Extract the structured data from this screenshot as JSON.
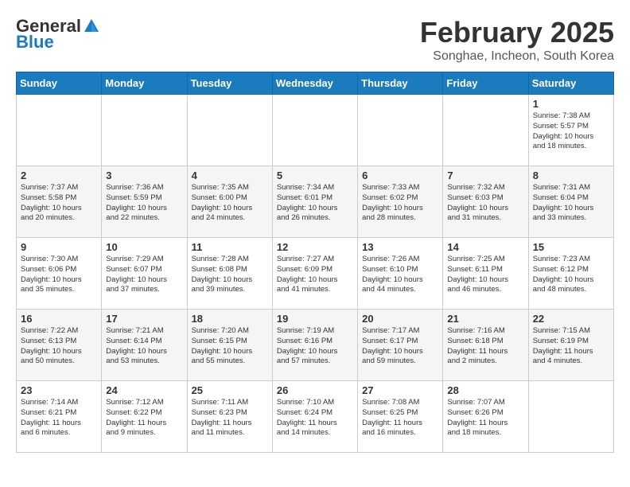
{
  "header": {
    "logo_general": "General",
    "logo_blue": "Blue",
    "month_title": "February 2025",
    "location": "Songhae, Incheon, South Korea"
  },
  "weekdays": [
    "Sunday",
    "Monday",
    "Tuesday",
    "Wednesday",
    "Thursday",
    "Friday",
    "Saturday"
  ],
  "weeks": [
    {
      "days": [
        {
          "num": "",
          "info": ""
        },
        {
          "num": "",
          "info": ""
        },
        {
          "num": "",
          "info": ""
        },
        {
          "num": "",
          "info": ""
        },
        {
          "num": "",
          "info": ""
        },
        {
          "num": "",
          "info": ""
        },
        {
          "num": "1",
          "info": "Sunrise: 7:38 AM\nSunset: 5:57 PM\nDaylight: 10 hours\nand 18 minutes."
        }
      ]
    },
    {
      "days": [
        {
          "num": "2",
          "info": "Sunrise: 7:37 AM\nSunset: 5:58 PM\nDaylight: 10 hours\nand 20 minutes."
        },
        {
          "num": "3",
          "info": "Sunrise: 7:36 AM\nSunset: 5:59 PM\nDaylight: 10 hours\nand 22 minutes."
        },
        {
          "num": "4",
          "info": "Sunrise: 7:35 AM\nSunset: 6:00 PM\nDaylight: 10 hours\nand 24 minutes."
        },
        {
          "num": "5",
          "info": "Sunrise: 7:34 AM\nSunset: 6:01 PM\nDaylight: 10 hours\nand 26 minutes."
        },
        {
          "num": "6",
          "info": "Sunrise: 7:33 AM\nSunset: 6:02 PM\nDaylight: 10 hours\nand 28 minutes."
        },
        {
          "num": "7",
          "info": "Sunrise: 7:32 AM\nSunset: 6:03 PM\nDaylight: 10 hours\nand 31 minutes."
        },
        {
          "num": "8",
          "info": "Sunrise: 7:31 AM\nSunset: 6:04 PM\nDaylight: 10 hours\nand 33 minutes."
        }
      ]
    },
    {
      "days": [
        {
          "num": "9",
          "info": "Sunrise: 7:30 AM\nSunset: 6:06 PM\nDaylight: 10 hours\nand 35 minutes."
        },
        {
          "num": "10",
          "info": "Sunrise: 7:29 AM\nSunset: 6:07 PM\nDaylight: 10 hours\nand 37 minutes."
        },
        {
          "num": "11",
          "info": "Sunrise: 7:28 AM\nSunset: 6:08 PM\nDaylight: 10 hours\nand 39 minutes."
        },
        {
          "num": "12",
          "info": "Sunrise: 7:27 AM\nSunset: 6:09 PM\nDaylight: 10 hours\nand 41 minutes."
        },
        {
          "num": "13",
          "info": "Sunrise: 7:26 AM\nSunset: 6:10 PM\nDaylight: 10 hours\nand 44 minutes."
        },
        {
          "num": "14",
          "info": "Sunrise: 7:25 AM\nSunset: 6:11 PM\nDaylight: 10 hours\nand 46 minutes."
        },
        {
          "num": "15",
          "info": "Sunrise: 7:23 AM\nSunset: 6:12 PM\nDaylight: 10 hours\nand 48 minutes."
        }
      ]
    },
    {
      "days": [
        {
          "num": "16",
          "info": "Sunrise: 7:22 AM\nSunset: 6:13 PM\nDaylight: 10 hours\nand 50 minutes."
        },
        {
          "num": "17",
          "info": "Sunrise: 7:21 AM\nSunset: 6:14 PM\nDaylight: 10 hours\nand 53 minutes."
        },
        {
          "num": "18",
          "info": "Sunrise: 7:20 AM\nSunset: 6:15 PM\nDaylight: 10 hours\nand 55 minutes."
        },
        {
          "num": "19",
          "info": "Sunrise: 7:19 AM\nSunset: 6:16 PM\nDaylight: 10 hours\nand 57 minutes."
        },
        {
          "num": "20",
          "info": "Sunrise: 7:17 AM\nSunset: 6:17 PM\nDaylight: 10 hours\nand 59 minutes."
        },
        {
          "num": "21",
          "info": "Sunrise: 7:16 AM\nSunset: 6:18 PM\nDaylight: 11 hours\nand 2 minutes."
        },
        {
          "num": "22",
          "info": "Sunrise: 7:15 AM\nSunset: 6:19 PM\nDaylight: 11 hours\nand 4 minutes."
        }
      ]
    },
    {
      "days": [
        {
          "num": "23",
          "info": "Sunrise: 7:14 AM\nSunset: 6:21 PM\nDaylight: 11 hours\nand 6 minutes."
        },
        {
          "num": "24",
          "info": "Sunrise: 7:12 AM\nSunset: 6:22 PM\nDaylight: 11 hours\nand 9 minutes."
        },
        {
          "num": "25",
          "info": "Sunrise: 7:11 AM\nSunset: 6:23 PM\nDaylight: 11 hours\nand 11 minutes."
        },
        {
          "num": "26",
          "info": "Sunrise: 7:10 AM\nSunset: 6:24 PM\nDaylight: 11 hours\nand 14 minutes."
        },
        {
          "num": "27",
          "info": "Sunrise: 7:08 AM\nSunset: 6:25 PM\nDaylight: 11 hours\nand 16 minutes."
        },
        {
          "num": "28",
          "info": "Sunrise: 7:07 AM\nSunset: 6:26 PM\nDaylight: 11 hours\nand 18 minutes."
        },
        {
          "num": "",
          "info": ""
        }
      ]
    }
  ]
}
